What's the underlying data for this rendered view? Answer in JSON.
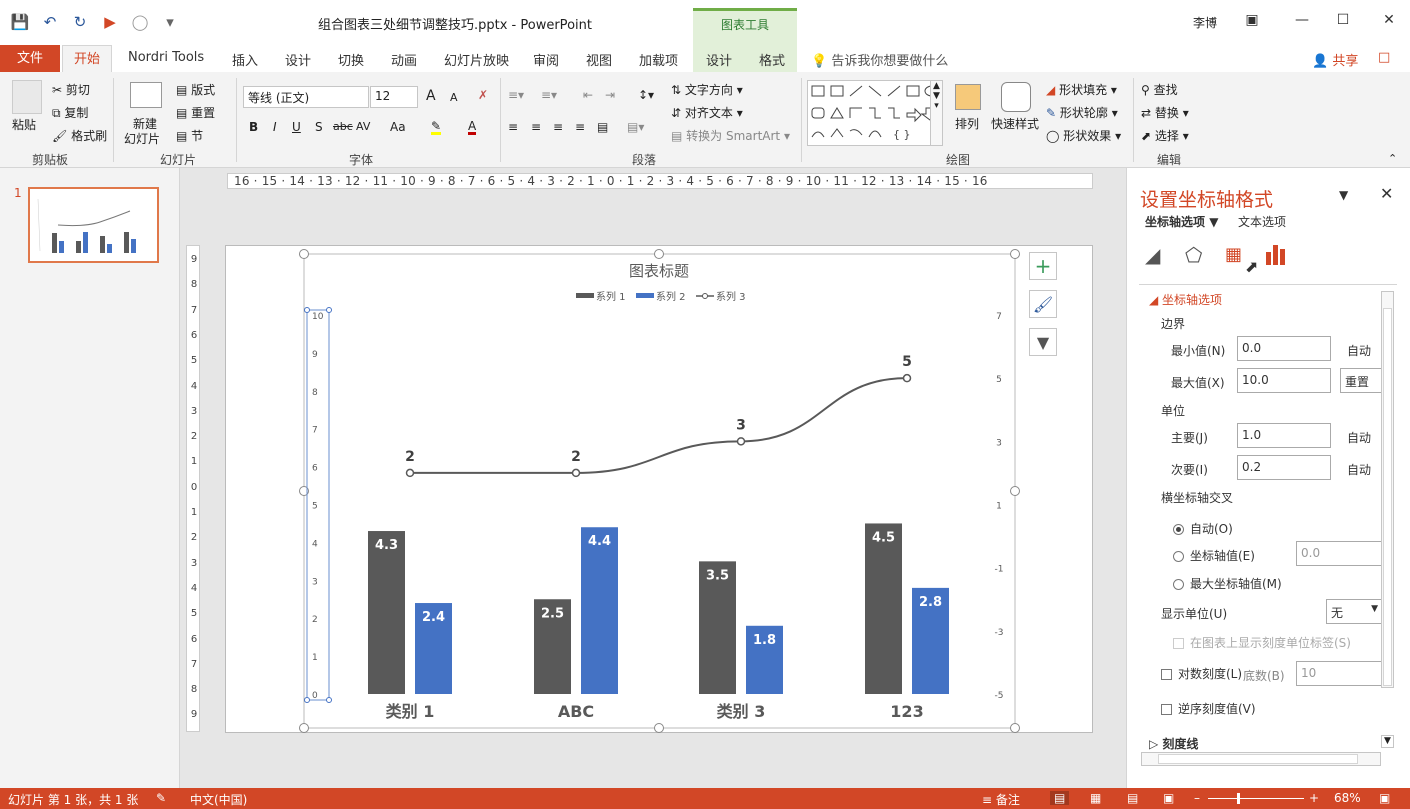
{
  "title_bar": {
    "document_title": "组合图表三处细节调整技巧.pptx  -  PowerPoint",
    "context_group": "图表工具",
    "user_name": "李博"
  },
  "tabs": {
    "file": "文件",
    "home": "开始",
    "items": [
      "Nordri Tools",
      "插入",
      "设计",
      "切换",
      "动画",
      "幻灯片放映",
      "审阅",
      "视图",
      "加载项"
    ],
    "chart_design": "设计",
    "chart_format": "格式",
    "tell_me": "告诉我你想要做什么",
    "share": "共享"
  },
  "ribbon": {
    "clipboard": {
      "paste": "粘贴",
      "cut": "剪切",
      "copy": "复制",
      "format_painter": "格式刷",
      "group": "剪贴板"
    },
    "slides": {
      "new_slide_1": "新建",
      "new_slide_2": "幻灯片",
      "layout": "版式",
      "reset": "重置",
      "section": "节",
      "group": "幻灯片"
    },
    "font": {
      "font_name": "等线 (正文)",
      "font_size": "12",
      "bold": "B",
      "italic": "I",
      "underline": "U",
      "shadow": "S",
      "strike": "abc",
      "spacing": "AV",
      "case": "Aa",
      "grow": "A",
      "shrink": "A",
      "color": "A",
      "group": "字体"
    },
    "paragraph": {
      "text_direction": "文字方向",
      "align_text": "对齐文本",
      "smartart": "转换为 SmartArt",
      "group": "段落"
    },
    "drawing": {
      "arrange": "排列",
      "quick_styles": "快速样式",
      "shape_fill": "形状填充",
      "shape_outline": "形状轮廓",
      "shape_effects": "形状效果",
      "group": "绘图",
      "shape_glyphs": "{ }"
    },
    "editing": {
      "find": "查找",
      "replace": "替换",
      "select": "选择",
      "group": "编辑"
    }
  },
  "thumbnails": {
    "slide_number": "1"
  },
  "ruler": {
    "horizontal": "16 · 15 · 14 · 13 · 12 · 11 · 10 · 9 · 8 · 7 · 6 · 5 · 4 · 3 · 2 · 1 · 0 · 1 · 2 · 3 · 4 · 5 · 6 · 7 · 8 · 9 · 10 · 11 · 12 · 13 · 14 · 15 · 16",
    "vertical": [
      "9",
      "8",
      "7",
      "6",
      "5",
      "4",
      "3",
      "2",
      "1",
      "0",
      "1",
      "2",
      "3",
      "4",
      "5",
      "6",
      "7",
      "8",
      "9"
    ]
  },
  "chart_data": {
    "type": "bar",
    "title": "图表标题",
    "categories": [
      "类别 1",
      "ABC",
      "类别 3",
      "123"
    ],
    "series": [
      {
        "name": "系列 1",
        "type": "bar",
        "values": [
          4.3,
          2.5,
          3.5,
          4.5
        ],
        "color": "#595959"
      },
      {
        "name": "系列 2",
        "type": "bar",
        "values": [
          2.4,
          4.4,
          1.8,
          2.8
        ],
        "color": "#4472c4"
      },
      {
        "name": "系列 3",
        "type": "line",
        "axis": "secondary",
        "values": [
          2,
          2,
          3,
          5
        ],
        "color": "#595959"
      }
    ],
    "primary_ylim": [
      0,
      10
    ],
    "primary_ticks": [
      "0",
      "1",
      "2",
      "3",
      "4",
      "5",
      "6",
      "7",
      "8",
      "9",
      "10"
    ],
    "secondary_ylim": [
      -5,
      7
    ],
    "secondary_ticks": [
      "-5",
      "-3",
      "-1",
      "1",
      "3",
      "5",
      "7"
    ],
    "legend_position": "top",
    "grid": false
  },
  "format_pane": {
    "title": "设置坐标轴格式",
    "tab_axis_options": "坐标轴选项",
    "tab_text_options": "文本选项",
    "section_axis_options": "坐标轴选项",
    "bounds": "边界",
    "min_label": "最小值(N)",
    "min_value": "0.0",
    "min_state": "自动",
    "max_label": "最大值(X)",
    "max_value": "10.0",
    "max_state": "重置",
    "units": "单位",
    "major_label": "主要(J)",
    "major_value": "1.0",
    "major_state": "自动",
    "minor_label": "次要(I)",
    "minor_value": "0.2",
    "minor_state": "自动",
    "cross_label": "横坐标轴交叉",
    "cross_auto": "自动(O)",
    "cross_value_label": "坐标轴值(E)",
    "cross_value": "0.0",
    "cross_max": "最大坐标轴值(M)",
    "display_units_label": "显示单位(U)",
    "display_units_value": "无",
    "show_units_label": "在图表上显示刻度单位标签(S)",
    "log_scale": "对数刻度(L)",
    "log_base_label": "底数(B)",
    "log_base_value": "10",
    "reverse": "逆序刻度值(V)",
    "tick_marks": "刻度线"
  },
  "status_bar": {
    "slide_info": "幻灯片 第 1 张，共 1 张",
    "language": "中文(中国)",
    "notes": "备注",
    "zoom": "68%"
  },
  "colors": {
    "accent": "#d24726",
    "chart_tools": "#e2f0d9",
    "series1": "#595959",
    "series2": "#4472c4"
  }
}
